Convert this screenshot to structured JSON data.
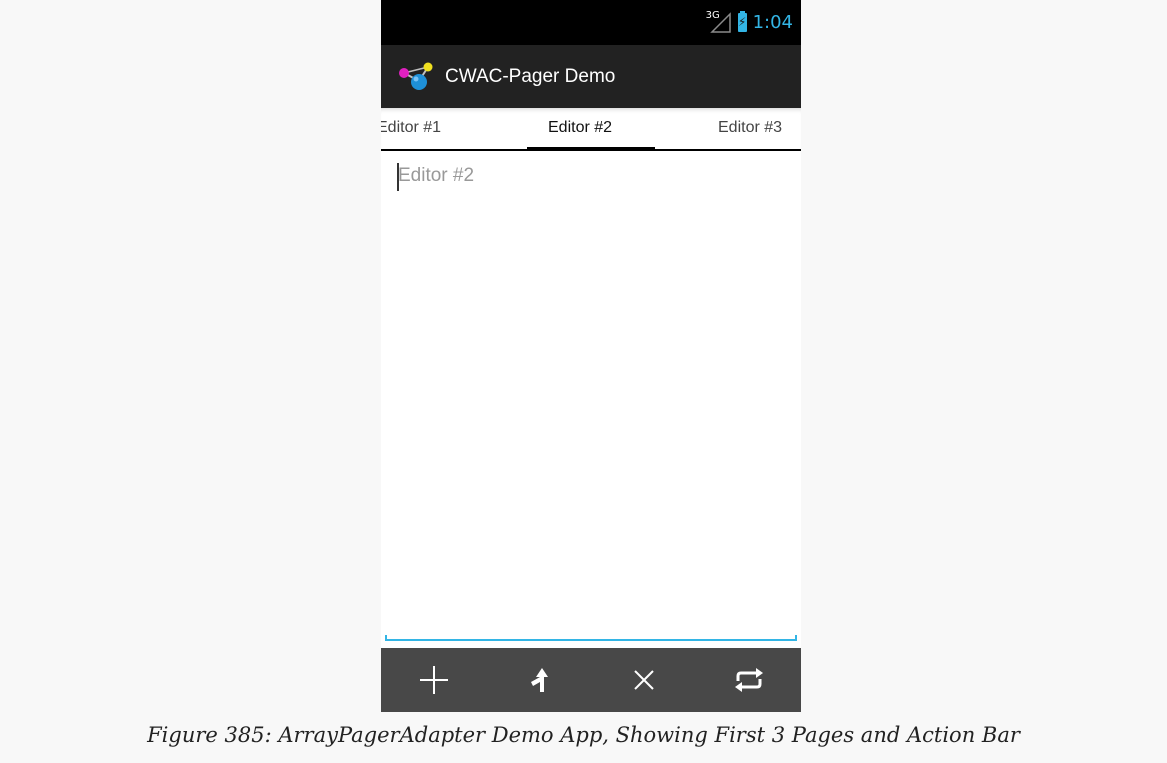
{
  "status_bar": {
    "network": "3G",
    "time": "1:04",
    "accent_color": "#33b5e5"
  },
  "action_bar": {
    "icon": "cwac-molecule-icon",
    "title": "CWAC-Pager Demo"
  },
  "tabs": [
    {
      "label": "Editor #1",
      "selected": false
    },
    {
      "label": "Editor #2",
      "selected": true
    },
    {
      "label": "Editor #3",
      "selected": false
    }
  ],
  "editor": {
    "placeholder": "Editor #2",
    "value": ""
  },
  "bottom_actions": [
    {
      "icon": "add-icon"
    },
    {
      "icon": "split-icon"
    },
    {
      "icon": "remove-icon"
    },
    {
      "icon": "swap-icon"
    }
  ],
  "caption": "Figure 385: ArrayPagerAdapter Demo App, Showing First 3 Pages and Action Bar"
}
